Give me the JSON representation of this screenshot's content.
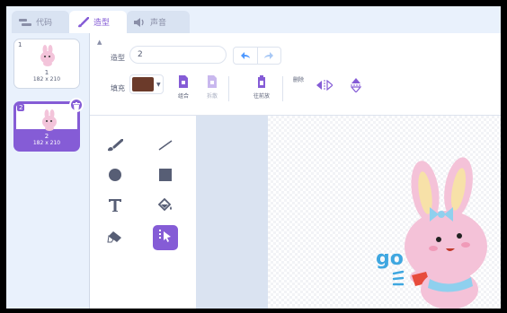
{
  "tabs": [
    {
      "label": "代码",
      "icon": "code-icon"
    },
    {
      "label": "造型",
      "icon": "paintbrush-icon"
    },
    {
      "label": "声音",
      "icon": "speaker-icon"
    }
  ],
  "costumes": [
    {
      "number": "1",
      "name": "1",
      "size": "182 x 210"
    },
    {
      "number": "2",
      "name": "2",
      "size": "182 x 210"
    }
  ],
  "editor": {
    "name_label": "造型",
    "name_value": "2",
    "fill_label": "填充",
    "fill_color": "#6b3a2a",
    "buttons": {
      "group": "组合",
      "ungroup": "拆散",
      "forward": "往前放",
      "delete": "删除"
    }
  },
  "tools": [
    "brush",
    "line",
    "circle",
    "rectangle",
    "text",
    "fill",
    "eraser",
    "select"
  ],
  "colors": {
    "accent": "#855cd6",
    "canvas_bg": "#dae3f1"
  }
}
